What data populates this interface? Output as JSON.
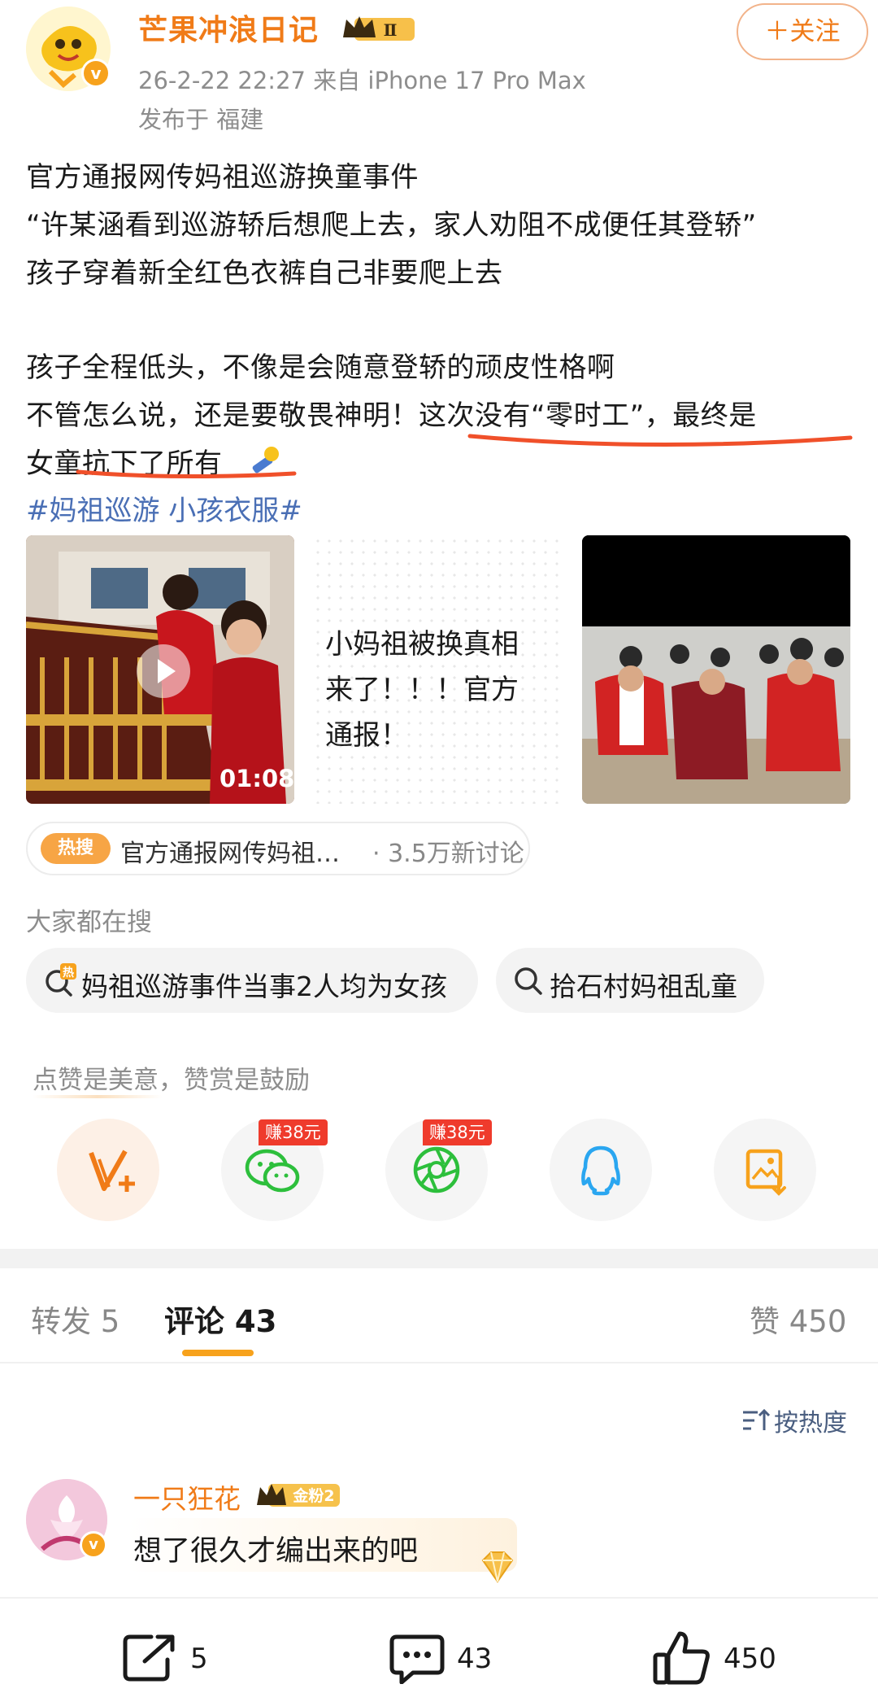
{
  "header": {
    "username": "芒果冲浪日记",
    "level_badge": "Ⅱ",
    "time_source": "26-2-22 22:27  来自 iPhone 17 Pro Max",
    "location": "发布于 福建",
    "follow_label": "＋关注"
  },
  "post": {
    "lines": [
      "官方通报网传妈祖巡游换童事件",
      "“许某涵看到巡游轿后想爬上去，家人劝阻不成便任其登轿”",
      "孩子穿着新全红色衣裤自己非要爬上去",
      "孩子全程低头，不像是会随意登轿的顽皮性格啊",
      "不管怎么说，还是要敬畏神明！这次没有“零时工”，最终是",
      "女童抗下了所有"
    ],
    "hashtags": "#妈祖巡游 小孩衣服#"
  },
  "media": {
    "video_duration": "01:08",
    "video_caption": "小妈祖被换真相来了！！！官方通报！"
  },
  "hot_search": {
    "tag": "热搜",
    "title": "官方通报网传妈祖…",
    "count": "· 3.5万新讨论"
  },
  "related_search": {
    "label": "大家都在搜",
    "chips": [
      {
        "badge": "热",
        "text": "妈祖巡游事件当事2人均为女孩"
      },
      {
        "text": "拾石村妈祖乱童"
      }
    ]
  },
  "reward": {
    "label": "点赞是美意，赞赏是鼓励",
    "earn_tag": "赚38元"
  },
  "tabs": {
    "repost_label": "转发",
    "repost_count": "5",
    "comment_label": "评论",
    "comment_count": "43",
    "like_label": "赞",
    "like_count": "450"
  },
  "sort_label": "按热度",
  "comment": {
    "author": "一只狂花",
    "fan_badge": "金粉2",
    "text": "想了很久才编出来的吧"
  },
  "bottom_bar": {
    "repost": "5",
    "comment": "43",
    "like": "450"
  },
  "colors": {
    "accent": "#f07b18",
    "link": "#4a6fb5",
    "underline": "#f0502a",
    "earn": "#ef3b2c"
  },
  "icons": [
    "v-plus-icon",
    "wechat-icon",
    "moments-icon",
    "qq-icon",
    "save-image-icon",
    "search-icon",
    "sort-icon",
    "repost-icon",
    "comment-icon",
    "like-icon",
    "play-icon",
    "crown-icon"
  ]
}
